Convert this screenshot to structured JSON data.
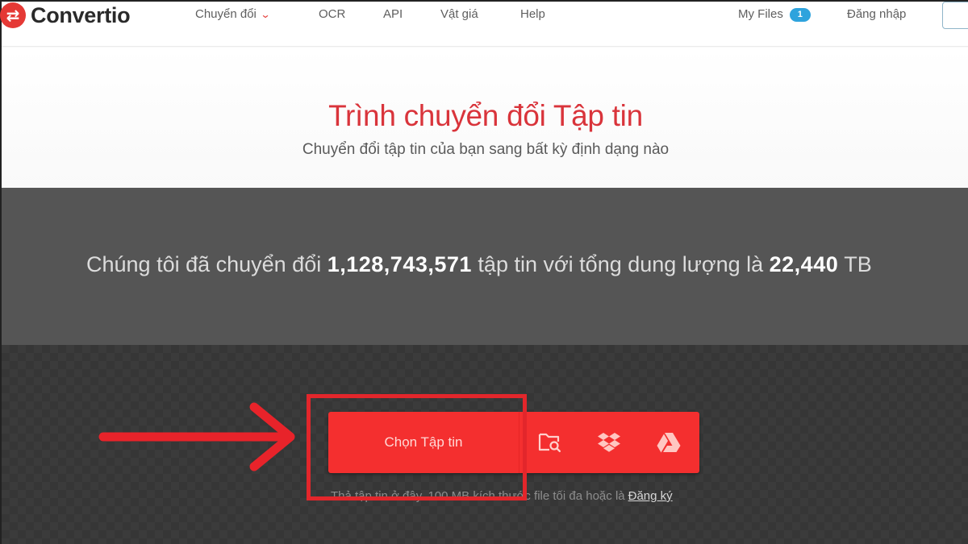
{
  "header": {
    "brand": "Convertio",
    "nav": [
      {
        "label": "Chuyển đổi",
        "has_dropdown": true
      },
      {
        "label": "OCR"
      },
      {
        "label": "API"
      },
      {
        "label": "Vật giá"
      },
      {
        "label": "Help"
      }
    ],
    "my_files_label": "My Files",
    "my_files_count": "1",
    "login_label": "Đăng nhập"
  },
  "hero": {
    "title": "Trình chuyển đổi Tập tin",
    "subtitle": "Chuyển đổi tập tin của bạn sang bất kỳ định dạng nào"
  },
  "stats": {
    "prefix": "Chúng tôi đã chuyển đổi",
    "files_converted": "1,128,743,571",
    "middle": "tập tin với tổng dung lượng là",
    "total_size": "22,440",
    "unit": "TB"
  },
  "upload": {
    "choose_label": "Chọn Tập tin",
    "sources": [
      {
        "icon": "folder-search-icon",
        "title": "From Computer"
      },
      {
        "icon": "dropbox-icon",
        "title": "From Dropbox"
      },
      {
        "icon": "google-drive-icon",
        "title": "From Google Drive"
      }
    ],
    "helper_text": "Thả tập tin ở đây. 100 MB kích thước file tối đa hoặc là",
    "signup_link": "Đăng ký"
  },
  "colors": {
    "brand_red": "#f42f2f",
    "title_red": "#d9343b",
    "badge_blue": "#2ea3dd",
    "annotation_red": "#e3262b"
  }
}
